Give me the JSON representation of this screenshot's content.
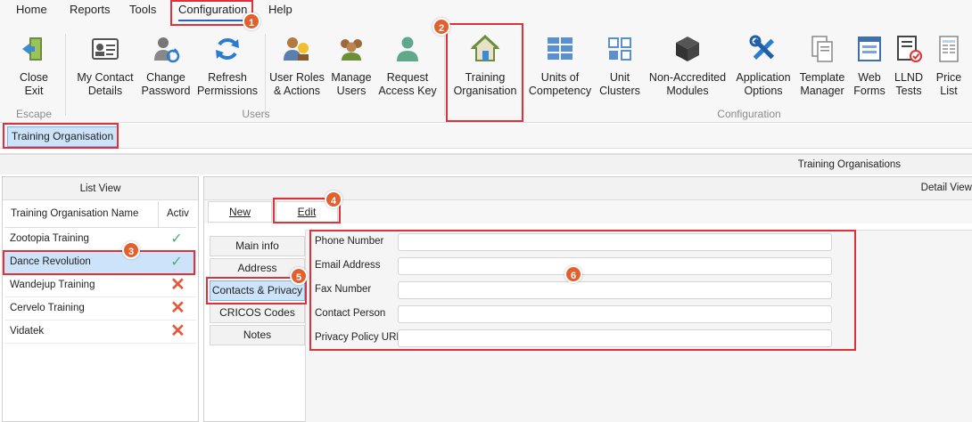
{
  "menu": {
    "items": [
      "Home",
      "Reports",
      "Tools",
      "Configuration",
      "Help"
    ]
  },
  "ribbon": {
    "escape_group": "Escape",
    "users_group": "Users",
    "configuration_group": "Configuration",
    "buttons": {
      "close_exit": "Close\nExit",
      "my_contact": "My Contact\nDetails",
      "change_password": "Change\nPassword",
      "refresh_permissions": "Refresh\nPermissions",
      "user_roles": "User Roles\n& Actions",
      "manage_users": "Manage\nUsers",
      "request_key": "Request\nAccess Key",
      "training_org": "Training\nOrganisation",
      "units_competency": "Units of\nCompetency",
      "unit_clusters": "Unit\nClusters",
      "non_accredited": "Non-Accredited\nModules",
      "app_options": "Application\nOptions",
      "template_manager": "Template\nManager",
      "web_forms": "Web\nForms",
      "llnd_tests": "LLND\nTests",
      "price_list": "Price\nList"
    }
  },
  "doc_tab": "Training Organisation",
  "section_title": "Training Organisations",
  "list_view": {
    "title": "List View",
    "col_name": "Training Organisation Name",
    "col_active": "Activ",
    "rows": [
      {
        "name": "Zootopia Training",
        "status": "✓"
      },
      {
        "name": "Dance Revolution",
        "status": "✓"
      },
      {
        "name": "Wandejup Training",
        "status": "✕"
      },
      {
        "name": "Cervelo Training",
        "status": "✕"
      },
      {
        "name": "Vidatek",
        "status": "✕"
      }
    ]
  },
  "detail_view": {
    "title": "Detail View",
    "new_btn": "New",
    "edit_btn": "Edit",
    "tabs": [
      "Main info",
      "Address",
      "Contacts & Privacy",
      "CRICOS Codes",
      "Notes"
    ],
    "fields": [
      "Phone Number",
      "Email Address",
      "Fax Number",
      "Contact Person",
      "Privacy Policy URL"
    ]
  },
  "annotations": [
    "1",
    "2",
    "3",
    "4",
    "5",
    "6"
  ],
  "colors": {
    "highlight": "#e0303a",
    "badge": "#e2602d",
    "selected": "#cde3f9",
    "check": "#4caf7f",
    "cross": "#e45b3c"
  }
}
